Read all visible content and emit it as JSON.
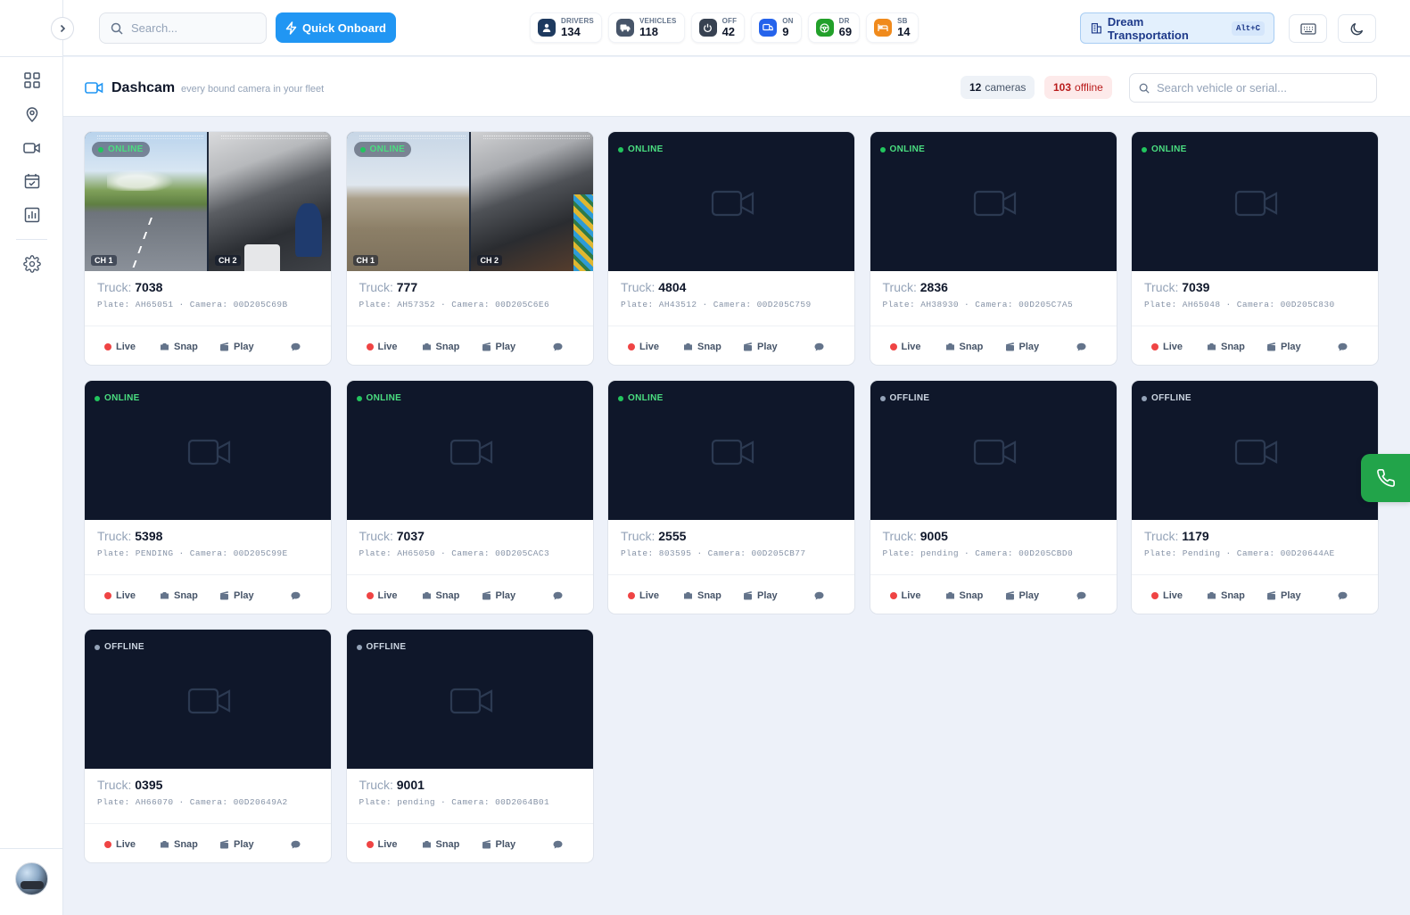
{
  "header": {
    "search_placeholder": "Search...",
    "quick_onboard_label": "Quick Onboard",
    "stats": [
      {
        "label": "DRIVERS",
        "value": "134",
        "icon": "user-icon",
        "color": "#1e3a5f"
      },
      {
        "label": "VEHICLES",
        "value": "118",
        "icon": "truck-icon",
        "color": "#475569"
      },
      {
        "label": "OFF",
        "value": "42",
        "icon": "power-icon",
        "color": "#374151"
      },
      {
        "label": "ON",
        "value": "9",
        "icon": "truck-icon",
        "color": "#2563eb"
      },
      {
        "label": "DR",
        "value": "69",
        "icon": "steering-wheel-icon",
        "color": "#22a02a"
      },
      {
        "label": "SB",
        "value": "14",
        "icon": "bed-icon",
        "color": "#f08a1c"
      }
    ],
    "company": "Dream Transportation",
    "company_shortcut": "Alt+C"
  },
  "page": {
    "title": "Dashcam",
    "subtitle": "every bound camera in your fleet",
    "cameras_count": "12",
    "cameras_label": "cameras",
    "offline_count": "103",
    "offline_label": "offline",
    "search_placeholder": "Search vehicle or serial..."
  },
  "labels": {
    "truck_prefix": "Truck:",
    "plate_prefix": "Plate:",
    "camera_prefix": "· Camera:",
    "live": "Live",
    "snap": "Snap",
    "play": "Play",
    "online": "ONLINE",
    "offline": "OFFLINE",
    "ch1": "CH 1",
    "ch2": "CH 2"
  },
  "cameras": [
    {
      "truck": "7038",
      "plate": "AH65051",
      "camera": "00D205C69B",
      "status": "online",
      "preview": "road"
    },
    {
      "truck": "777",
      "plate": "AH57352",
      "camera": "00D205C6E6",
      "status": "online",
      "preview": "field"
    },
    {
      "truck": "4804",
      "plate": "AH43512",
      "camera": "00D205C759",
      "status": "online",
      "preview": "none"
    },
    {
      "truck": "2836",
      "plate": "AH38930",
      "camera": "00D205C7A5",
      "status": "online",
      "preview": "none"
    },
    {
      "truck": "7039",
      "plate": "AH65048",
      "camera": "00D205C830",
      "status": "online",
      "preview": "none"
    },
    {
      "truck": "5398",
      "plate": "PENDING",
      "camera": "00D205C99E",
      "status": "online",
      "preview": "none"
    },
    {
      "truck": "7037",
      "plate": "AH65050",
      "camera": "00D205CAC3",
      "status": "online",
      "preview": "none"
    },
    {
      "truck": "2555",
      "plate": "803595",
      "camera": "00D205CB77",
      "status": "online",
      "preview": "none"
    },
    {
      "truck": "9005",
      "plate": "pending",
      "camera": "00D205CBD0",
      "status": "offline",
      "preview": "none"
    },
    {
      "truck": "1179",
      "plate": "Pending",
      "camera": "00D20644AE",
      "status": "offline",
      "preview": "none"
    },
    {
      "truck": "0395",
      "plate": "AH66070",
      "camera": "00D20649A2",
      "status": "offline",
      "preview": "none"
    },
    {
      "truck": "9001",
      "plate": "pending",
      "camera": "00D2064B01",
      "status": "offline",
      "preview": "none"
    }
  ],
  "colors": {
    "accent": "#2196f3",
    "online": "#22c55e",
    "offline": "#94a3b8",
    "live_dot": "#ef4444",
    "thumb_bg": "#0f172a",
    "phone_fab": "#22a44a"
  }
}
